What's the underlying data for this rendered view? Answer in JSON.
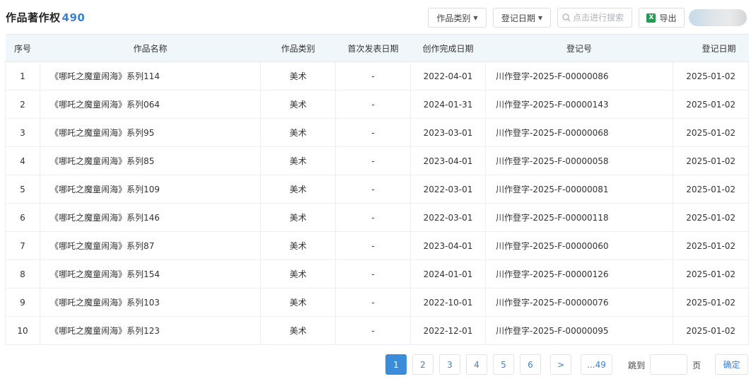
{
  "header": {
    "title": "作品著作权",
    "count": "490",
    "category_button": "作品类别",
    "date_button": "登记日期",
    "search_placeholder": "点击进行搜索",
    "export_button": "导出",
    "excel_glyph": "X"
  },
  "table": {
    "columns": [
      "序号",
      "作品名称",
      "作品类别",
      "首次发表日期",
      "创作完成日期",
      "登记号",
      "登记日期"
    ],
    "rows": [
      {
        "index": "1",
        "name": "《哪吒之魔童闹海》系列114",
        "category": "美术",
        "first_pub": "-",
        "completed": "2022-04-01",
        "reg_no": "川作登字-2025-F-00000086",
        "reg_date": "2025-01-02"
      },
      {
        "index": "2",
        "name": "《哪吒之魔童闹海》系列064",
        "category": "美术",
        "first_pub": "-",
        "completed": "2024-01-31",
        "reg_no": "川作登字-2025-F-00000143",
        "reg_date": "2025-01-02"
      },
      {
        "index": "3",
        "name": "《哪吒之魔童闹海》系列95",
        "category": "美术",
        "first_pub": "-",
        "completed": "2023-03-01",
        "reg_no": "川作登字-2025-F-00000068",
        "reg_date": "2025-01-02"
      },
      {
        "index": "4",
        "name": "《哪吒之魔童闹海》系列85",
        "category": "美术",
        "first_pub": "-",
        "completed": "2023-04-01",
        "reg_no": "川作登字-2025-F-00000058",
        "reg_date": "2025-01-02"
      },
      {
        "index": "5",
        "name": "《哪吒之魔童闹海》系列109",
        "category": "美术",
        "first_pub": "-",
        "completed": "2022-03-01",
        "reg_no": "川作登字-2025-F-00000081",
        "reg_date": "2025-01-02"
      },
      {
        "index": "6",
        "name": "《哪吒之魔童闹海》系列146",
        "category": "美术",
        "first_pub": "-",
        "completed": "2022-03-01",
        "reg_no": "川作登字-2025-F-00000118",
        "reg_date": "2025-01-02"
      },
      {
        "index": "7",
        "name": "《哪吒之魔童闹海》系列87",
        "category": "美术",
        "first_pub": "-",
        "completed": "2023-04-01",
        "reg_no": "川作登字-2025-F-00000060",
        "reg_date": "2025-01-02"
      },
      {
        "index": "8",
        "name": "《哪吒之魔童闹海》系列154",
        "category": "美术",
        "first_pub": "-",
        "completed": "2024-01-01",
        "reg_no": "川作登字-2025-F-00000126",
        "reg_date": "2025-01-02"
      },
      {
        "index": "9",
        "name": "《哪吒之魔童闹海》系列103",
        "category": "美术",
        "first_pub": "-",
        "completed": "2022-10-01",
        "reg_no": "川作登字-2025-F-00000076",
        "reg_date": "2025-01-02"
      },
      {
        "index": "10",
        "name": "《哪吒之魔童闹海》系列123",
        "category": "美术",
        "first_pub": "-",
        "completed": "2022-12-01",
        "reg_no": "川作登字-2025-F-00000095",
        "reg_date": "2025-01-02"
      }
    ]
  },
  "pagination": {
    "pages": [
      "1",
      "2",
      "3",
      "4",
      "5",
      "6"
    ],
    "current": "1",
    "next": ">",
    "last": "...49",
    "jump_label": "跳到",
    "page_label": "页",
    "confirm": "确定"
  },
  "colors": {
    "accent": "#3b82d6",
    "header_bg": "#f0f7fb",
    "active_page": "#3b8ddb"
  }
}
